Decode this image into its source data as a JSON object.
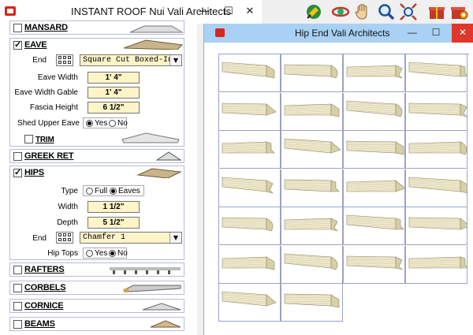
{
  "left_window": {
    "title": "INSTANT ROOF Nui   Vali Architects",
    "controls": [
      "minimize-icon",
      "maximize-icon",
      "close-icon"
    ]
  },
  "toolbar": {
    "icons": [
      "pointer-paint-icon",
      "orbit-icon",
      "pan-hand-icon",
      "zoom-icon",
      "zoom-extents-icon",
      "gift-icon",
      "gift-gear-icon"
    ]
  },
  "sections": {
    "mansard": {
      "label": "MANSARD",
      "checked": false
    },
    "eave": {
      "label": "EAVE",
      "checked": true,
      "end_label": "End",
      "end_value": "Square Cut Boxed-In",
      "eave_width_label": "Eave Width",
      "eave_width_value": "1' 4\"",
      "eave_width_gable_label": "Eave Width Gable",
      "eave_width_gable_value": "1' 4\"",
      "fascia_height_label": "Fascia Height",
      "fascia_height_value": "6 1/2\"",
      "shed_upper_eave_label": "Shed Upper Eave",
      "yes_label": "Yes",
      "no_label": "No",
      "shed_selected": "Yes",
      "trim_label": "TRIM",
      "trim_checked": false
    },
    "greek_ret": {
      "label": "GREEK RET",
      "checked": false
    },
    "hips": {
      "label": "HIPS",
      "checked": true,
      "type_label": "Type",
      "full_label": "Full",
      "eaves_label": "Eaves",
      "type_selected": "Eaves",
      "width_label": "Width",
      "width_value": "1 1/2\"",
      "depth_label": "Depth",
      "depth_value": "5 1/2\"",
      "end_label": "End",
      "end_value": "Chamfer 1",
      "hip_tops_label": "Hip Tops",
      "yes_label": "Yes",
      "no_label": "No",
      "hip_tops_selected": "No"
    },
    "rafters": {
      "label": "RAFTERS",
      "checked": false
    },
    "corbels": {
      "label": "CORBELS",
      "checked": false
    },
    "cornice": {
      "label": "CORNICE",
      "checked": false
    },
    "beams": {
      "label": "BEAMS",
      "checked": false
    }
  },
  "right_window": {
    "title": "Hip End    Vali Architects",
    "controls": [
      "minimize-icon",
      "maximize-icon",
      "close-icon"
    ],
    "gallery_count": 26,
    "thumbnail_colors": {
      "light": "#efe9cf",
      "mid": "#d8cfa6",
      "dark": "#8a8267"
    }
  }
}
